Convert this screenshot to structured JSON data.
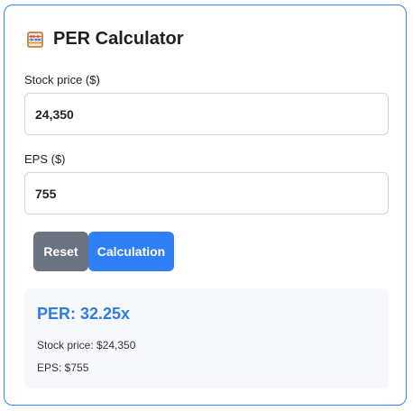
{
  "app": {
    "title": "PER Calculator",
    "icon": "abacus-icon"
  },
  "form": {
    "stock_price_label": "Stock price ($)",
    "stock_price_value": "24,350",
    "eps_label": "EPS ($)",
    "eps_value": "755"
  },
  "buttons": {
    "reset_label": "Reset",
    "calculate_label": "Calculation"
  },
  "result": {
    "per_text": "PER: 32.25x",
    "stock_price_text": "Stock price: $24,350",
    "eps_text": "EPS: $755"
  },
  "colors": {
    "accent": "#2f80f6",
    "reset_button": "#6b7280",
    "card_border": "#3b82f6",
    "result_bg": "#f6f8fb",
    "per_text": "#2f7be8"
  }
}
